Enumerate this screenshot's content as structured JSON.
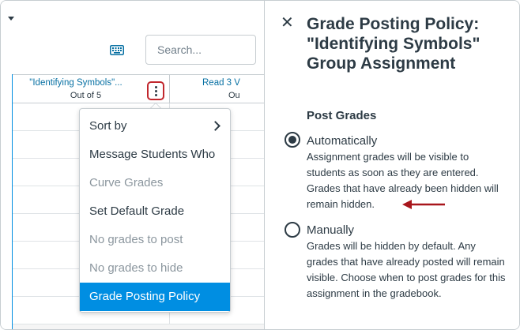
{
  "gradebook": {
    "search_placeholder": "Search...",
    "columns": [
      {
        "title": "\"Identifying Symbols\"...",
        "subtitle": "Out of 5"
      },
      {
        "title": "Read 3 V",
        "subtitle": "Ou"
      }
    ],
    "menu_items": [
      {
        "label": "Sort by",
        "state": "normal",
        "submenu": true
      },
      {
        "label": "Message Students Who",
        "state": "normal"
      },
      {
        "label": "Curve Grades",
        "state": "disabled"
      },
      {
        "label": "Set Default Grade",
        "state": "normal"
      },
      {
        "label": "No grades to post",
        "state": "disabled"
      },
      {
        "label": "No grades to hide",
        "state": "disabled"
      },
      {
        "label": "Grade Posting Policy",
        "state": "active"
      }
    ]
  },
  "tray": {
    "title": "Grade Posting Policy: \"Identifying Symbols\" Group Assignment",
    "section_heading": "Post Grades",
    "options": [
      {
        "label": "Automatically",
        "checked": true,
        "description": "Assignment grades will be visible to students as soon as they are entered. Grades that have already been hidden will remain hidden."
      },
      {
        "label": "Manually",
        "checked": false,
        "description": "Grades will be hidden by default. Any grades that have already posted will remain visible. Choose when to post grades for this assignment in the gradebook."
      }
    ]
  },
  "colors": {
    "accent": "#008ee2",
    "link": "#0770a3",
    "highlight_border": "#c1272d",
    "annotation_arrow": "#a8161c"
  }
}
